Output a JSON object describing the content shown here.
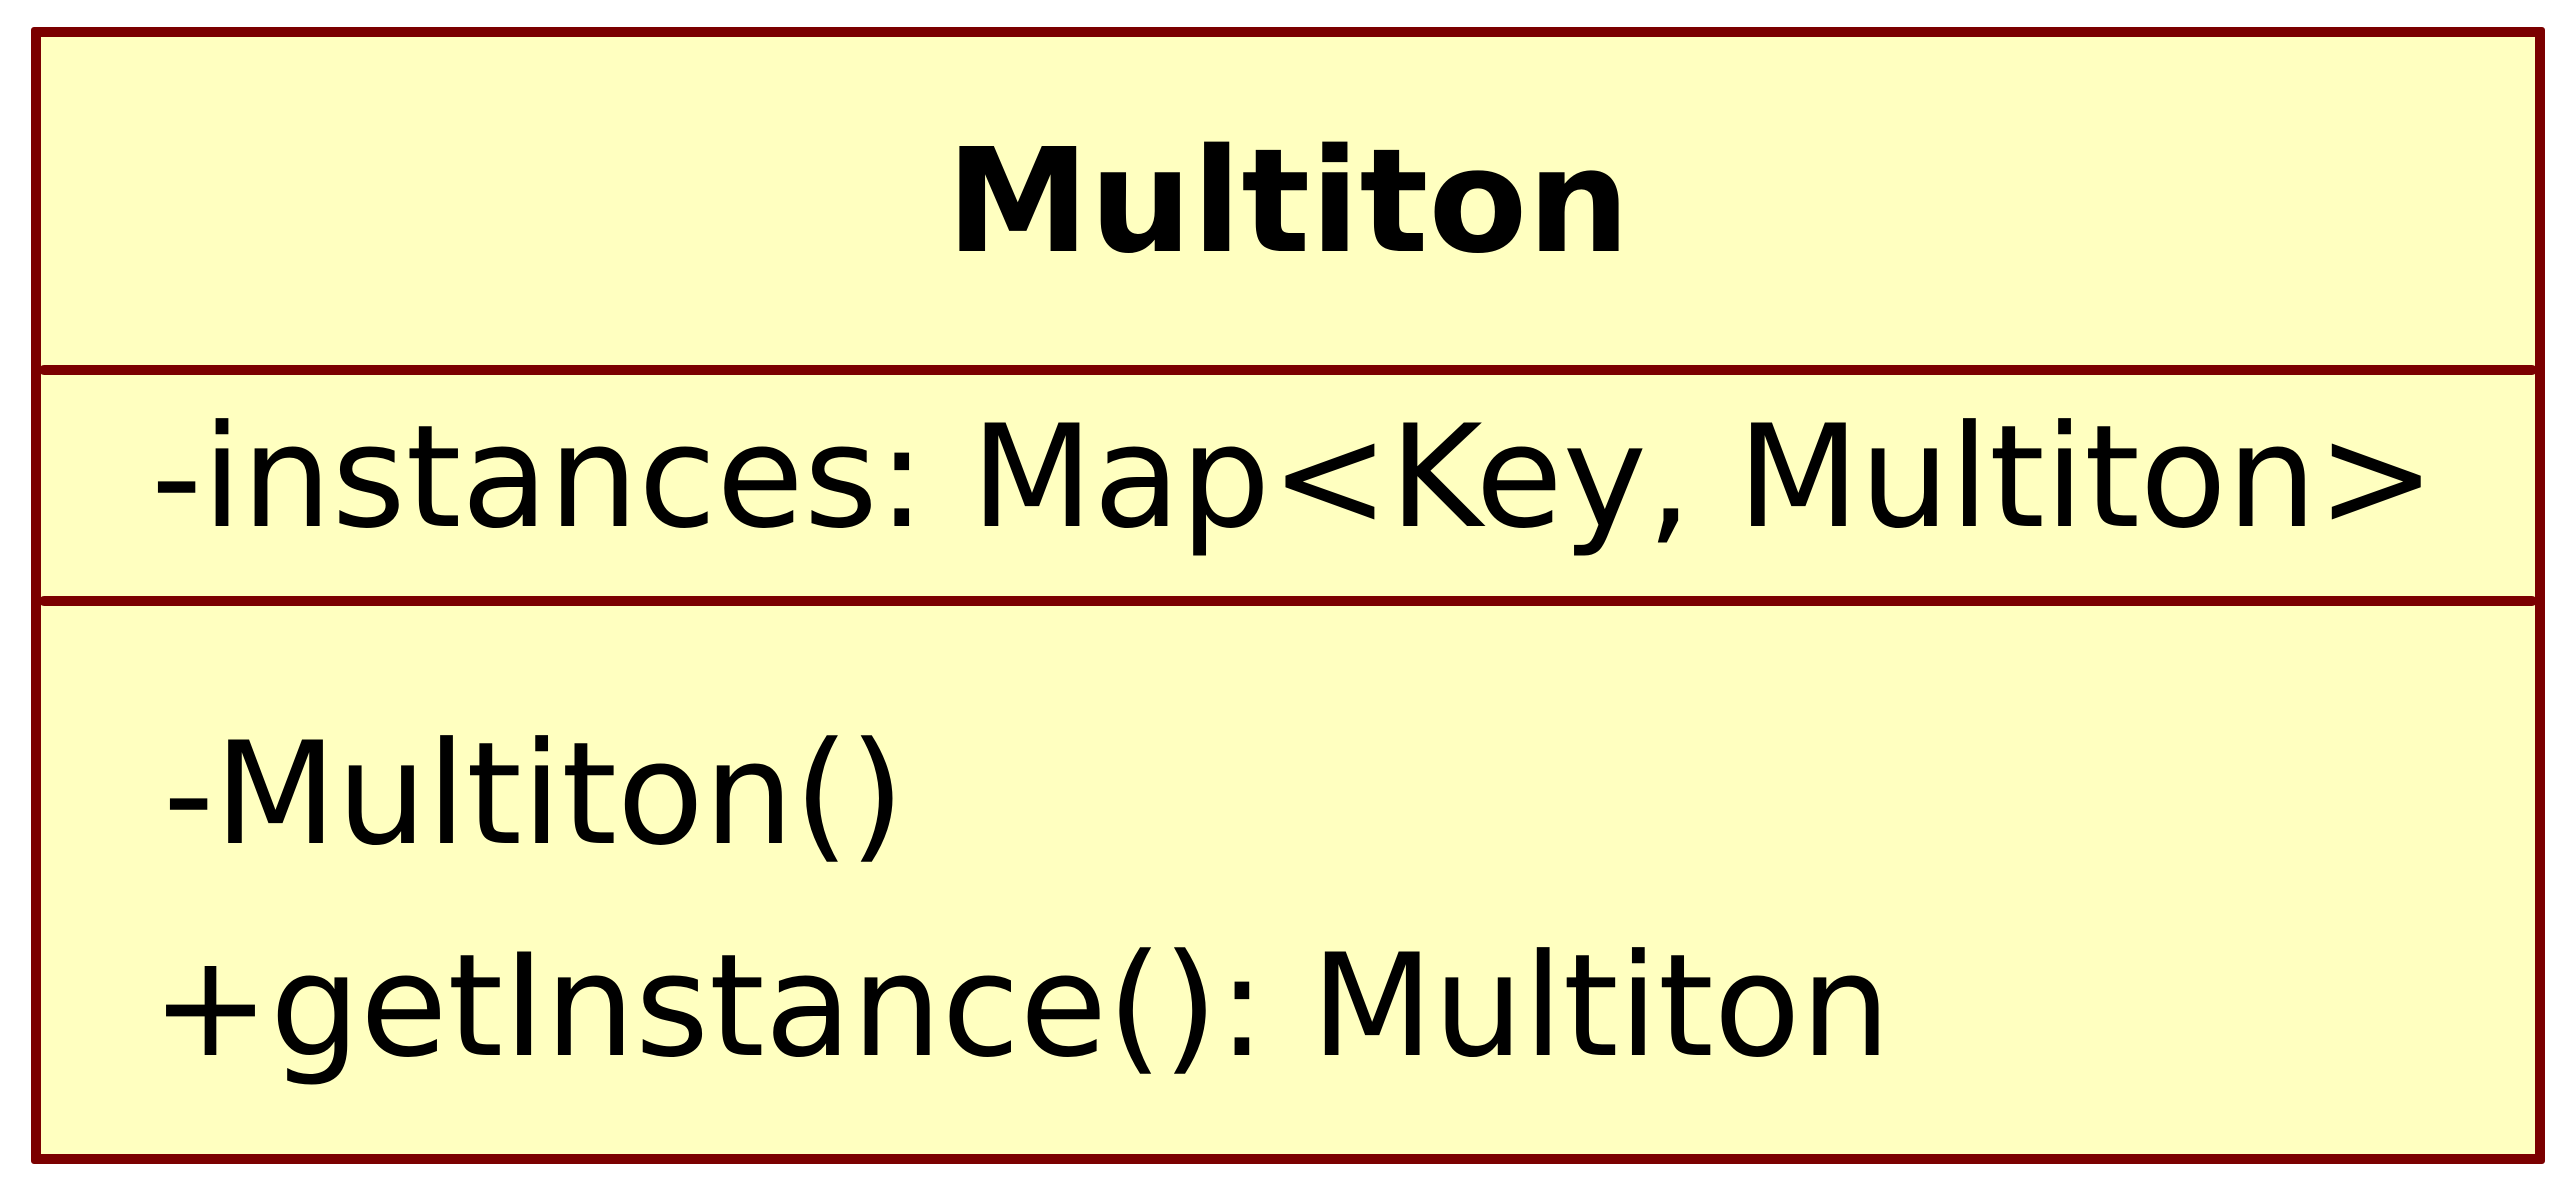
{
  "diagram": {
    "type": "uml-class",
    "colors": {
      "fill": "#ffffc0",
      "border": "#7b0000",
      "text": "#000000"
    },
    "class": {
      "name": "Multiton",
      "attributes": [
        "-instances: Map<Key, Multiton>"
      ],
      "operations": [
        "-Multiton()",
        "+getInstance(): Multiton"
      ]
    }
  }
}
